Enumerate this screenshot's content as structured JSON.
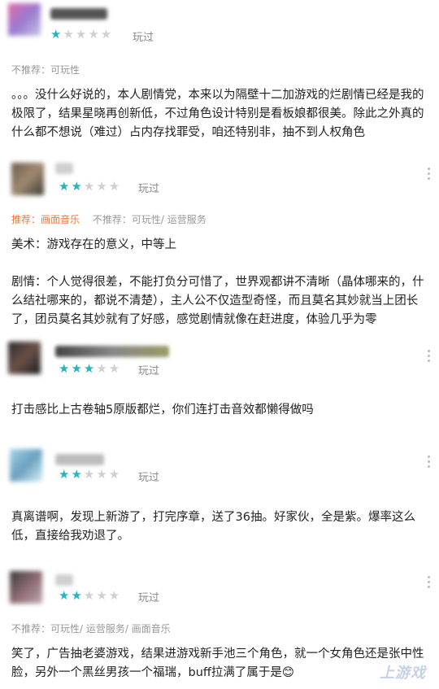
{
  "reviews": [
    {
      "stars": "★★★★★",
      "rating": 1,
      "played": "玩过",
      "tags": {
        "recommend": "",
        "not_recommend": "不推荐：可玩性"
      },
      "text": "。。。没什么好说的，本人剧情党，本来以为隔壁十二加游戏的烂剧情已经是我的极限了，结果星晓再创新低，不过角色设计特别是看板娘都很美。除此之外真的什么都不想说（难过）占内存找罪受，咱还特别非，抽不到人权角色"
    },
    {
      "stars": "★★★★★",
      "rating": 2,
      "played": "玩过",
      "tags": {
        "recommend": "推荐：画面音乐",
        "not_recommend": "不推荐：可玩性/ 运营服务"
      },
      "text": "美术：游戏存在的意义，中等上\n\n剧情：个人觉得很差，不能打负分可惜了，世界观都讲不清晰（晶体哪来的，什么结社哪来的，都说不清楚），主人公不仅造型奇怪，而且莫名其妙就当上团长了，团员莫名其妙就有了好感，感觉剧情就像在赶进度，体验几乎为零"
    },
    {
      "stars": "★★★★★",
      "rating": 3,
      "played": "玩过",
      "tags": {
        "recommend": "",
        "not_recommend": ""
      },
      "text": "打击感比上古卷轴5原版都烂，你们连打击音效都懒得做吗"
    },
    {
      "stars": "★★★★★",
      "rating": 2,
      "played": "玩过",
      "tags": {
        "recommend": "",
        "not_recommend": ""
      },
      "text": "真离谱啊，发现上新游了，打完序章，送了36抽。好家伙，全是紫。爆率这么低，直接给我劝退了。"
    },
    {
      "stars": "★★★★★",
      "rating": 2,
      "played": "玩过",
      "tags": {
        "recommend": "",
        "not_recommend": "不推荐：可玩性/ 运营服务/ 画面音乐"
      },
      "text": "笑了，广告抽老婆游戏，结果进游戏新手池三个角色，就一个女角色还是张中性脸，另外一个黑丝男孩一个福瑞，buff拉满了属于是😊"
    }
  ],
  "watermark": "上游戏",
  "colors": {
    "star_on": "#26b3c2",
    "star_off": "#d0d0d0",
    "recommend": "#f07a3a"
  }
}
